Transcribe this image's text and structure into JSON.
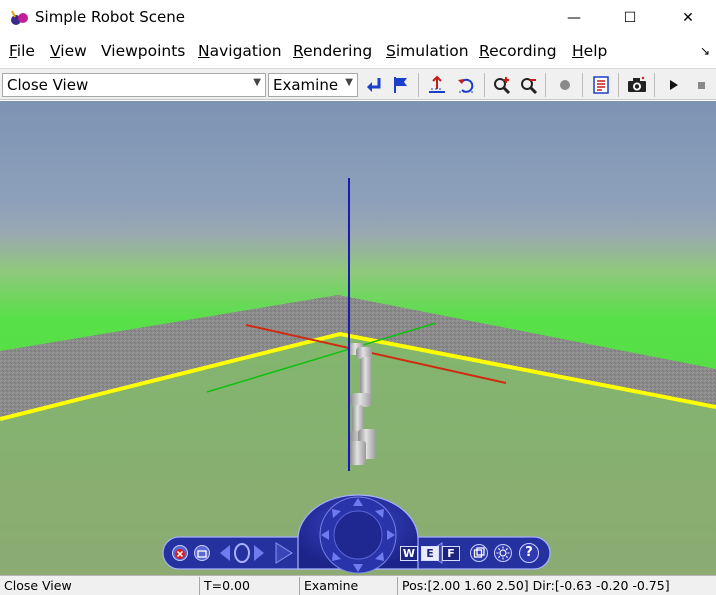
{
  "window": {
    "title": "Simple Robot Scene",
    "minimize_glyph": "—",
    "maximize_glyph": "☐",
    "close_glyph": "✕"
  },
  "menu": {
    "items": [
      {
        "label_first": "F",
        "label_rest": "ile"
      },
      {
        "label_first": "V",
        "label_rest": "iew"
      },
      {
        "label_first": "",
        "label_rest": "Viewpoints"
      },
      {
        "label_first": "N",
        "label_rest": "avigation"
      },
      {
        "label_first": "R",
        "label_rest": "endering"
      },
      {
        "label_first": "S",
        "label_rest": "imulation"
      },
      {
        "label_first": "R",
        "label_rest": "ecording"
      },
      {
        "label_first": "H",
        "label_rest": "elp"
      }
    ],
    "overflow_glyph": "↘"
  },
  "toolbar": {
    "viewpoint_select": "Close View",
    "mode_select": "Examine",
    "icons": [
      "return-icon",
      "flag-icon",
      "straighten-up-icon",
      "undo-move-icon",
      "zoom-in-icon",
      "zoom-out-icon",
      "record-dot-icon",
      "properties-icon",
      "camera-icon",
      "play-icon",
      "stop-icon"
    ]
  },
  "nav_widget": {
    "walk_label": "W",
    "examine_label": "E",
    "fly_label": "F",
    "help_label": "?"
  },
  "status": {
    "viewpoint": "Close View",
    "time": "T=0.00",
    "mode": "Examine",
    "pose": "Pos:[2.00 1.60 2.50] Dir:[-0.63 -0.20 -0.75]"
  },
  "colors": {
    "sky_top": "#7c93b3",
    "horizon_green": "#58e048",
    "floor": "#898989",
    "boundary": "#ffff00",
    "axis_x": "#d02a10",
    "axis_y": "#10c010",
    "axis_z": "#1a1ab0",
    "widget": "#2630a0"
  }
}
